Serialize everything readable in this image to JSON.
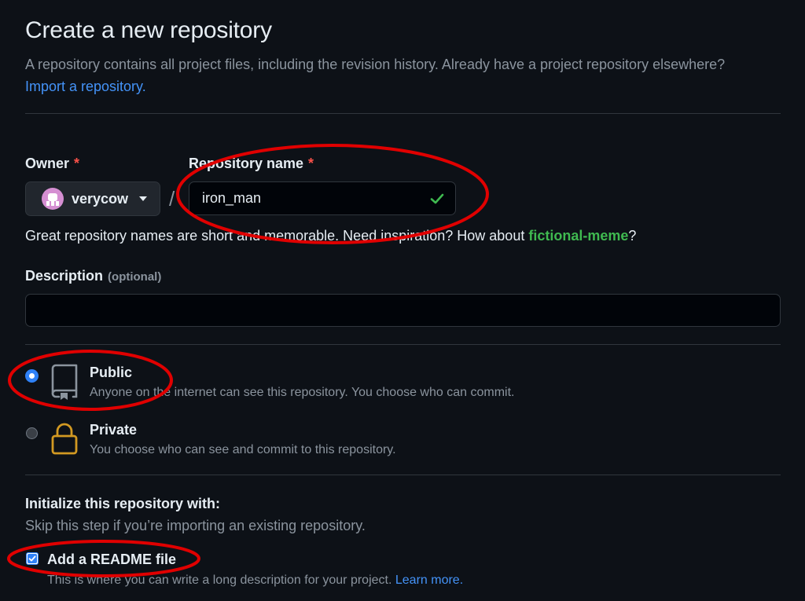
{
  "header": {
    "title": "Create a new repository",
    "intro": "A repository contains all project files, including the revision history. Already have a project repository elsewhere?",
    "import_link": "Import a repository."
  },
  "owner": {
    "label": "Owner",
    "required_mark": "*",
    "value": "verycow"
  },
  "repo": {
    "label": "Repository name",
    "required_mark": "*",
    "value": "iron_man",
    "valid": true
  },
  "hint": {
    "text": "Great repository names are short and memorable. Need inspiration? How about",
    "suggestion": "fictional-meme",
    "end": "?"
  },
  "description": {
    "label": "Description",
    "optional": "(optional)",
    "value": ""
  },
  "visibility": {
    "public": {
      "title": "Public",
      "desc": "Anyone on the internet can see this repository. You choose who can commit.",
      "selected": true,
      "icon": "repo-icon"
    },
    "private": {
      "title": "Private",
      "desc": "You choose who can see and commit to this repository.",
      "selected": false,
      "icon": "lock-icon"
    }
  },
  "init": {
    "heading": "Initialize this repository with:",
    "subtext": "Skip this step if you’re importing an existing repository.",
    "readme_label": "Add a README file",
    "readme_checked": true,
    "readme_desc": "This is where you can write a long description for your project.",
    "learn_more": "Learn more."
  },
  "colors": {
    "background": "#0d1117",
    "accent": "#2f81f7",
    "link": "#4493f8",
    "success": "#3fb950",
    "required": "#f85149",
    "annotation": "#e00000"
  }
}
